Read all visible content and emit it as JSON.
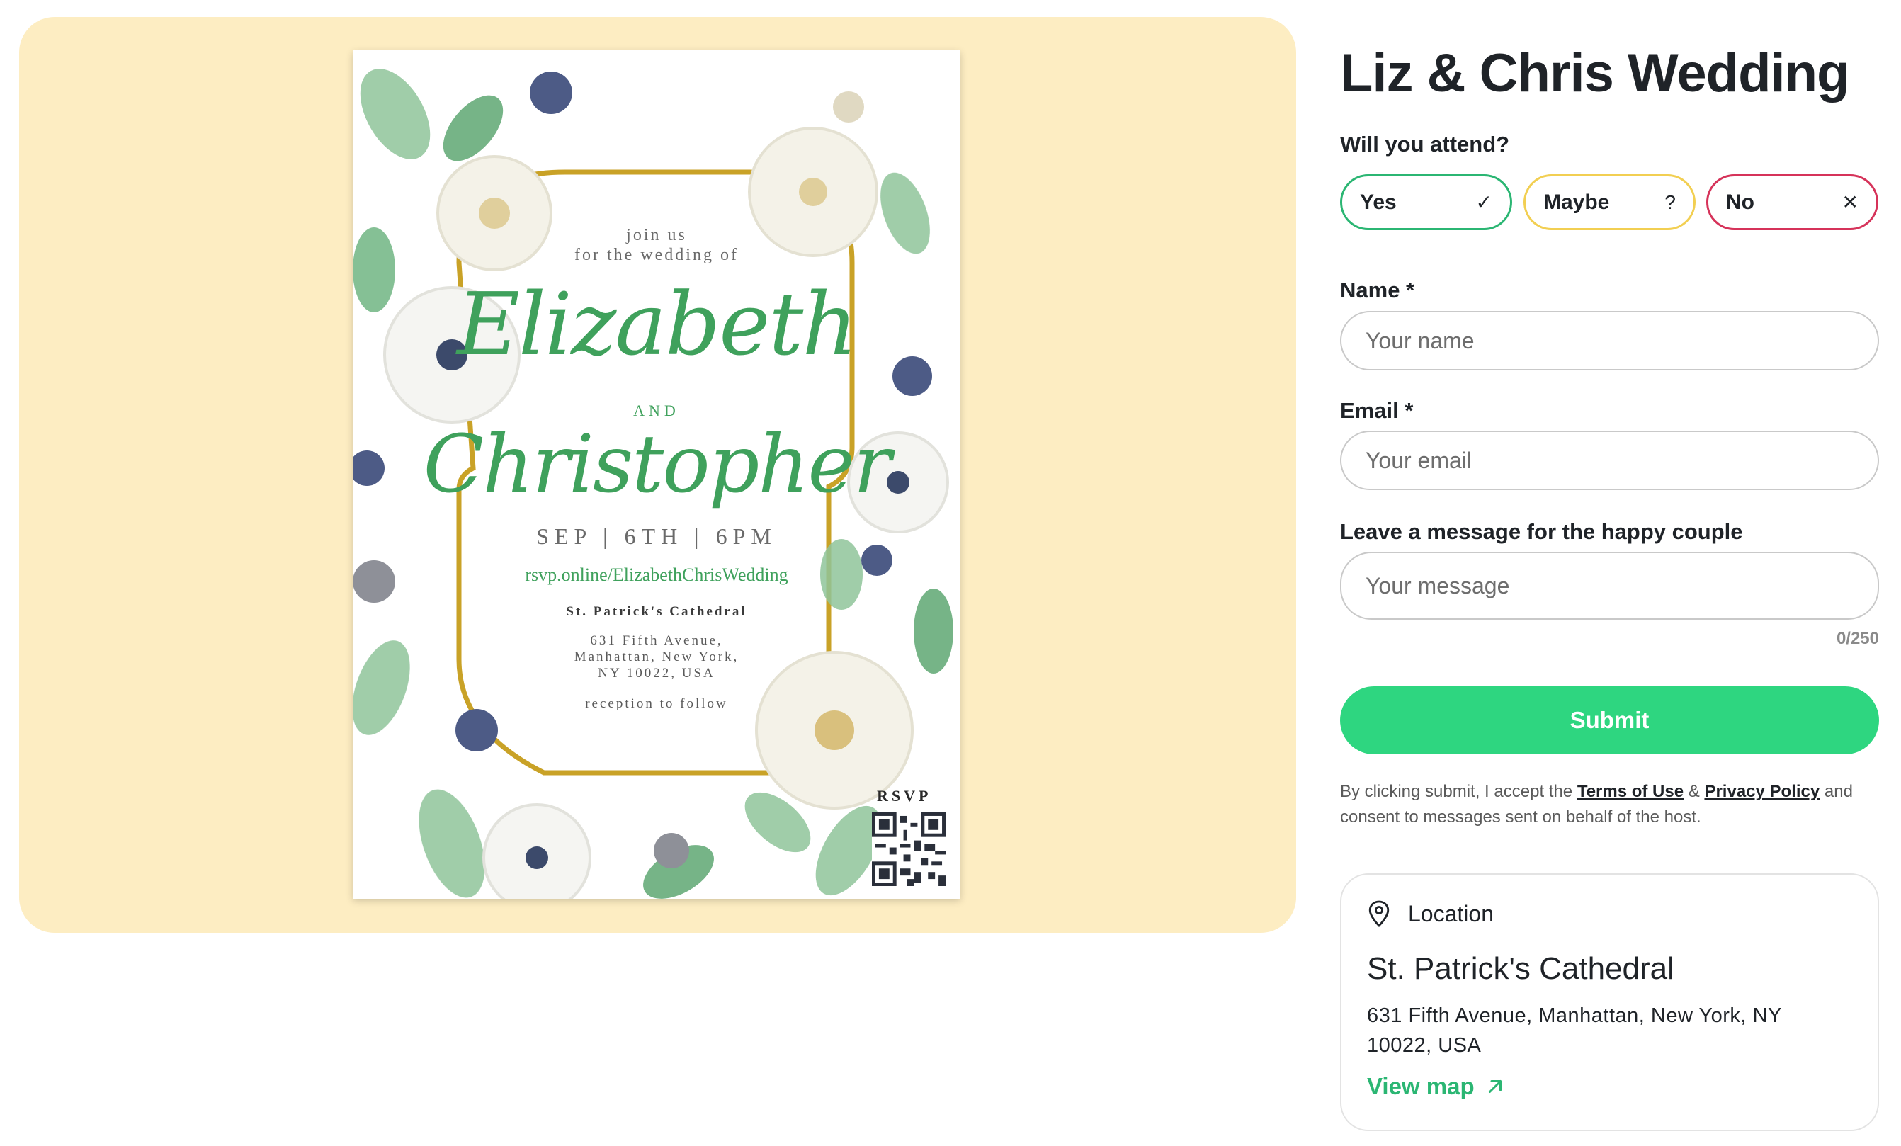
{
  "invitation": {
    "join_us": "join us",
    "for_the_wedding_of": "for the wedding of",
    "name_one": "Elizabeth",
    "and": "AND",
    "name_two": "Christopher",
    "date_line": "SEP | 6TH | 6PM",
    "rsvp_url": "rsvp.online/ElizabethChrisWedding",
    "venue": "St. Patrick's Cathedral",
    "address_line1": "631 Fifth Avenue,",
    "address_line2": "Manhattan, New York,",
    "address_line3": "NY 10022, USA",
    "reception": "reception to follow",
    "rsvp_label": "RSVP"
  },
  "form": {
    "title": "Liz & Chris Wedding",
    "attend_question": "Will you attend?",
    "options": [
      {
        "label": "Yes",
        "icon": "check-icon",
        "color": "#2bb673"
      },
      {
        "label": "Maybe",
        "icon": "question-icon",
        "color": "#f2cf52"
      },
      {
        "label": "No",
        "icon": "close-icon",
        "color": "#d6335a"
      }
    ],
    "name_label": "Name *",
    "name_placeholder": "Your name",
    "name_value": "",
    "email_label": "Email *",
    "email_placeholder": "Your email",
    "email_value": "",
    "message_label": "Leave a message for the happy couple",
    "message_placeholder": "Your message",
    "message_value": "",
    "counter": "0/250",
    "submit_label": "Submit",
    "legal_prefix": "By clicking submit, I accept the",
    "terms_link": "Terms of Use",
    "ampersand": "&",
    "privacy_link": "Privacy Policy",
    "legal_suffix": "and consent to messages sent on behalf of the host."
  },
  "location": {
    "heading": "Location",
    "icon": "map-pin-icon",
    "name": "St. Patrick's Cathedral",
    "address": "631 Fifth Avenue, Manhattan, New York, NY 10022, USA",
    "map_link": "View map",
    "map_icon": "arrow-up-right-icon"
  },
  "colors": {
    "panel_bg": "#fdedc2",
    "accent_green": "#2ed680",
    "invite_green": "#3fa15c",
    "gold": "#c9a227"
  }
}
